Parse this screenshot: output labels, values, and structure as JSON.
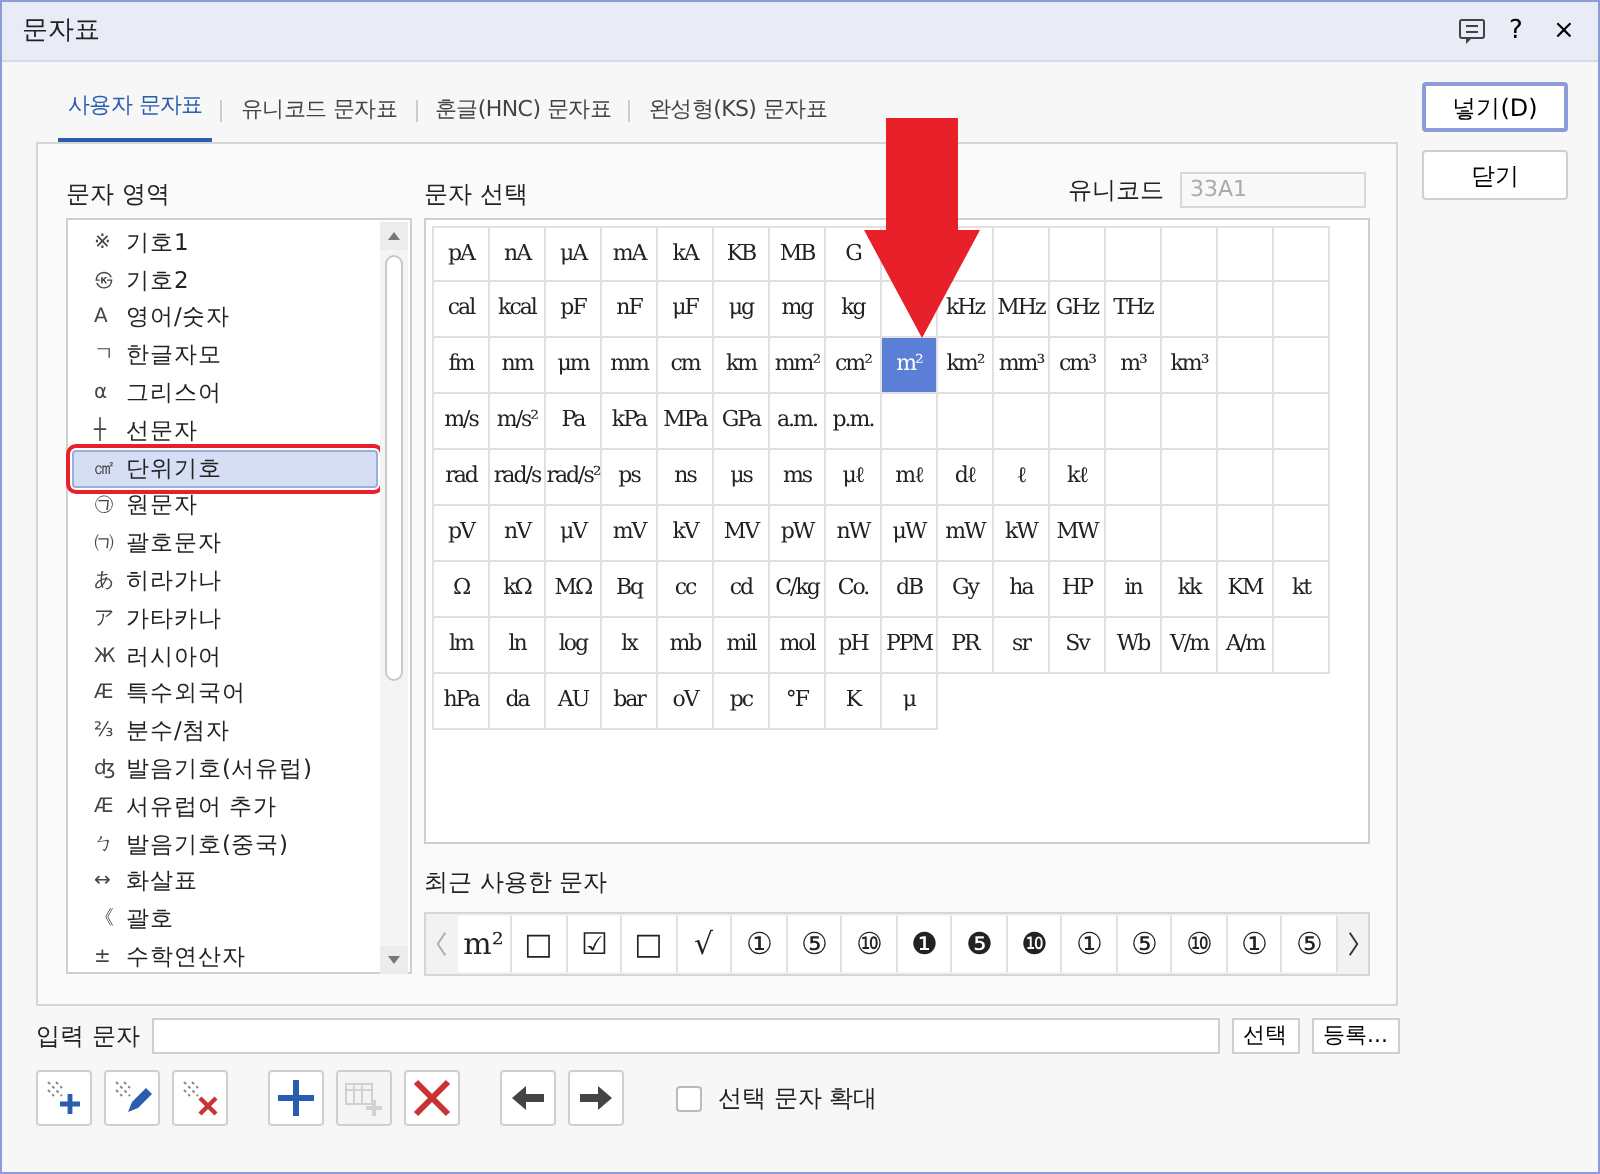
{
  "window": {
    "title": "문자표",
    "help": "?",
    "close": "×"
  },
  "tabs": [
    {
      "label": "사용자 문자표",
      "selected": true
    },
    {
      "label": "유니코드 문자표",
      "selected": false
    },
    {
      "label": "훈글(HNC) 문자표",
      "selected": false
    },
    {
      "label": "완성형(KS) 문자표",
      "selected": false
    }
  ],
  "side_buttons": [
    "넣기(D)",
    "닫기"
  ],
  "category": {
    "label": "문자 영역",
    "items": [
      {
        "glyph": "※",
        "label": "기호1",
        "selected": false,
        "highlighted": false
      },
      {
        "glyph": "㉿",
        "label": "기호2",
        "selected": false,
        "highlighted": false
      },
      {
        "glyph": "A",
        "label": "영어/숫자",
        "selected": false,
        "highlighted": false
      },
      {
        "glyph": "ㄱ",
        "label": "한글자모",
        "selected": false,
        "highlighted": false
      },
      {
        "glyph": "α",
        "label": "그리스어",
        "selected": false,
        "highlighted": false
      },
      {
        "glyph": "┼",
        "label": "선문자",
        "selected": false,
        "highlighted": false
      },
      {
        "glyph": "㎠",
        "label": "단위기호",
        "selected": true,
        "highlighted": true
      },
      {
        "glyph": "㉠",
        "label": "원문자",
        "selected": false,
        "highlighted": false
      },
      {
        "glyph": "㈀",
        "label": "괄호문자",
        "selected": false,
        "highlighted": false
      },
      {
        "glyph": "あ",
        "label": "히라가나",
        "selected": false,
        "highlighted": false
      },
      {
        "glyph": "ア",
        "label": "가타카나",
        "selected": false,
        "highlighted": false
      },
      {
        "glyph": "Ж",
        "label": "러시아어",
        "selected": false,
        "highlighted": false
      },
      {
        "glyph": "Æ",
        "label": "특수외국어",
        "selected": false,
        "highlighted": false
      },
      {
        "glyph": "⅔",
        "label": "분수/첨자",
        "selected": false,
        "highlighted": false
      },
      {
        "glyph": "ʤ",
        "label": "발음기호(서유럽)",
        "selected": false,
        "highlighted": false
      },
      {
        "glyph": "Æ",
        "label": "서유럽어 추가",
        "selected": false,
        "highlighted": false
      },
      {
        "glyph": "ㄅ",
        "label": "발음기호(중국)",
        "selected": false,
        "highlighted": false
      },
      {
        "glyph": "↔",
        "label": "화살표",
        "selected": false,
        "highlighted": false
      },
      {
        "glyph": "《",
        "label": "괄호",
        "selected": false,
        "highlighted": false
      },
      {
        "glyph": "±",
        "label": "수학연산자",
        "selected": false,
        "highlighted": false
      }
    ]
  },
  "symbols": {
    "label": "문자 선택",
    "unicode_label": "유니코드",
    "unicode_value": "33A1",
    "rows": [
      [
        {
          "text": "pA",
          "selected": false
        },
        {
          "text": "nA",
          "selected": false
        },
        {
          "text": "μA",
          "selected": false
        },
        {
          "text": "mA",
          "selected": false
        },
        {
          "text": "kA",
          "selected": false
        },
        {
          "text": "KB",
          "selected": false
        },
        {
          "text": "MB",
          "selected": false
        },
        {
          "text": "G",
          "selected": false
        }
      ],
      [
        {
          "text": "cal",
          "selected": false
        },
        {
          "text": "kcal",
          "selected": false
        },
        {
          "text": "pF",
          "selected": false
        },
        {
          "text": "nF",
          "selected": false
        },
        {
          "text": "μF",
          "selected": false
        },
        {
          "text": "μg",
          "selected": false
        },
        {
          "text": "mg",
          "selected": false
        },
        {
          "text": "kg",
          "selected": false
        },
        null,
        {
          "text": "kHz",
          "selected": false
        },
        {
          "text": "MHz",
          "selected": false
        },
        {
          "text": "GHz",
          "selected": false
        },
        {
          "text": "THz",
          "selected": false
        }
      ],
      [
        {
          "text": "fm",
          "selected": false
        },
        {
          "text": "nm",
          "selected": false
        },
        {
          "text": "μm",
          "selected": false
        },
        {
          "text": "mm",
          "selected": false
        },
        {
          "text": "cm",
          "selected": false
        },
        {
          "text": "km",
          "selected": false
        },
        {
          "text": "mm²",
          "selected": false
        },
        {
          "text": "cm²",
          "selected": false
        },
        {
          "text": "m²",
          "selected": true
        },
        {
          "text": "km²",
          "selected": false
        },
        {
          "text": "mm³",
          "selected": false
        },
        {
          "text": "cm³",
          "selected": false
        },
        {
          "text": "m³",
          "selected": false
        },
        {
          "text": "km³",
          "selected": false
        }
      ],
      [
        {
          "text": "m/s",
          "selected": false
        },
        {
          "text": "m/s²",
          "selected": false
        },
        {
          "text": "Pa",
          "selected": false
        },
        {
          "text": "kPa",
          "selected": false
        },
        {
          "text": "MPa",
          "selected": false
        },
        {
          "text": "GPa",
          "selected": false
        },
        {
          "text": "a.m.",
          "selected": false
        },
        {
          "text": "p.m.",
          "selected": false
        }
      ],
      [
        {
          "text": "rad",
          "selected": false
        },
        {
          "text": "rad/s",
          "selected": false
        },
        {
          "text": "rad/s²",
          "selected": false
        },
        {
          "text": "ps",
          "selected": false
        },
        {
          "text": "ns",
          "selected": false
        },
        {
          "text": "μs",
          "selected": false
        },
        {
          "text": "ms",
          "selected": false
        },
        {
          "text": "μℓ",
          "selected": false
        },
        {
          "text": "mℓ",
          "selected": false
        },
        {
          "text": "dℓ",
          "selected": false
        },
        {
          "text": "ℓ",
          "selected": false
        },
        {
          "text": "kℓ",
          "selected": false
        }
      ],
      [
        {
          "text": "pV",
          "selected": false
        },
        {
          "text": "nV",
          "selected": false
        },
        {
          "text": "μV",
          "selected": false
        },
        {
          "text": "mV",
          "selected": false
        },
        {
          "text": "kV",
          "selected": false
        },
        {
          "text": "MV",
          "selected": false
        },
        {
          "text": "pW",
          "selected": false
        },
        {
          "text": "nW",
          "selected": false
        },
        {
          "text": "μW",
          "selected": false
        },
        {
          "text": "mW",
          "selected": false
        },
        {
          "text": "kW",
          "selected": false
        },
        {
          "text": "MW",
          "selected": false
        }
      ],
      [
        {
          "text": "Ω",
          "selected": false
        },
        {
          "text": "kΩ",
          "selected": false
        },
        {
          "text": "MΩ",
          "selected": false
        },
        {
          "text": "Bq",
          "selected": false
        },
        {
          "text": "cc",
          "selected": false
        },
        {
          "text": "cd",
          "selected": false
        },
        {
          "text": "C/kg",
          "selected": false
        },
        {
          "text": "Co.",
          "selected": false
        },
        {
          "text": "dB",
          "selected": false
        },
        {
          "text": "Gy",
          "selected": false
        },
        {
          "text": "ha",
          "selected": false
        },
        {
          "text": "HP",
          "selected": false
        },
        {
          "text": "in",
          "selected": false
        },
        {
          "text": "kk",
          "selected": false
        },
        {
          "text": "KM",
          "selected": false
        },
        {
          "text": "kt",
          "selected": false
        }
      ],
      [
        {
          "text": "lm",
          "selected": false
        },
        {
          "text": "ln",
          "selected": false
        },
        {
          "text": "log",
          "selected": false
        },
        {
          "text": "lx",
          "selected": false
        },
        {
          "text": "mb",
          "selected": false
        },
        {
          "text": "mil",
          "selected": false
        },
        {
          "text": "mol",
          "selected": false
        },
        {
          "text": "pH",
          "selected": false
        },
        {
          "text": "PPM",
          "selected": false
        },
        {
          "text": "PR",
          "selected": false
        },
        {
          "text": "sr",
          "selected": false
        },
        {
          "text": "Sv",
          "selected": false
        },
        {
          "text": "Wb",
          "selected": false
        },
        {
          "text": "V/m",
          "selected": false
        },
        {
          "text": "A/m",
          "selected": false
        }
      ],
      [
        {
          "text": "hPa",
          "selected": false
        },
        {
          "text": "da",
          "selected": false
        },
        {
          "text": "AU",
          "selected": false
        },
        {
          "text": "bar",
          "selected": false
        },
        {
          "text": "oV",
          "selected": false
        },
        {
          "text": "pc",
          "selected": false
        },
        {
          "text": "°F",
          "selected": false
        },
        {
          "text": "K",
          "selected": false
        },
        {
          "text": "μ",
          "selected": false
        }
      ]
    ]
  },
  "recent": {
    "label": "최근 사용한 문자",
    "items": [
      "m²",
      "□",
      "☑",
      "□",
      "√",
      "①",
      "⑤",
      "⑩",
      "❶",
      "❺",
      "❿",
      "①",
      "⑤",
      "⑩",
      "①",
      "⑤"
    ]
  },
  "input": {
    "label": "입력 문자",
    "buttons": [
      "선택",
      "등록..."
    ]
  },
  "toolbar": [
    {
      "kind": "add-symbol",
      "disabled": false
    },
    {
      "kind": "edit-symbol",
      "disabled": false
    },
    {
      "kind": "delete-symbol",
      "disabled": false
    },
    {
      "kind": "add",
      "disabled": false
    },
    {
      "kind": "add-table",
      "disabled": true
    },
    {
      "kind": "delete",
      "disabled": false
    },
    {
      "kind": "left",
      "disabled": false
    },
    {
      "kind": "right",
      "disabled": false
    }
  ],
  "enlarge": {
    "label": "선택 문자 확대",
    "checked": false
  }
}
